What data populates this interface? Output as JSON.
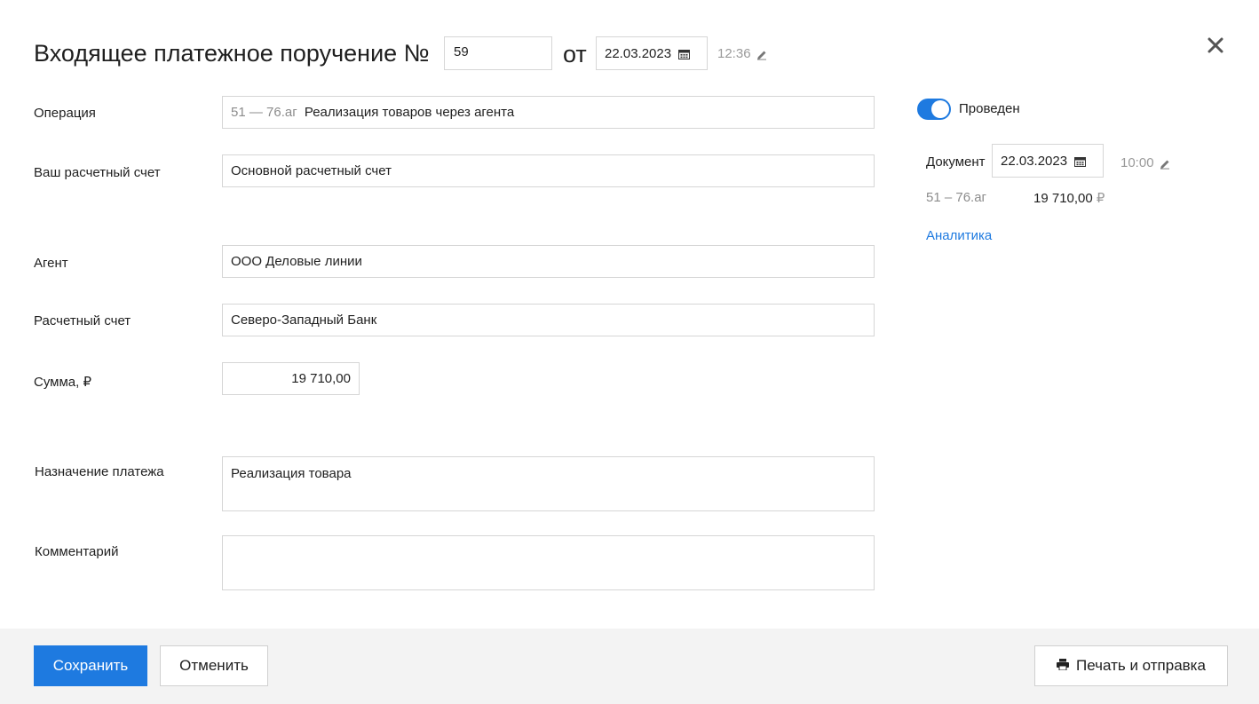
{
  "header": {
    "title": "Входящее платежное поручение №",
    "number": "59",
    "from_label": "от",
    "date": "22.03.2023",
    "time": "12:36"
  },
  "form": {
    "operation": {
      "label": "Операция",
      "code": "51 — 76.аг",
      "value": "Реализация товаров через агента"
    },
    "own_account": {
      "label": "Ваш расчетный счет",
      "value": "Основной расчетный счет"
    },
    "agent": {
      "label": "Агент",
      "value": "ООО Деловые линии"
    },
    "account": {
      "label": "Расчетный счет",
      "value": "Северо-Западный Банк"
    },
    "sum": {
      "label": "Сумма, ₽",
      "value": "19 710,00"
    },
    "purpose": {
      "label": "Назначение платежа",
      "value": "Реализация товара"
    },
    "comment": {
      "label": "Комментарий",
      "value": ""
    }
  },
  "side": {
    "posted_label": "Проведен",
    "posted": true,
    "document_label": "Документ",
    "document_date": "22.03.2023",
    "document_time": "10:00",
    "entry_code": "51 – 76.аг",
    "entry_sum": "19 710,00",
    "currency": "₽",
    "analytics_link": "Аналитика"
  },
  "footer": {
    "save_label": "Сохранить",
    "cancel_label": "Отменить",
    "print_label": "Печать и отправка"
  },
  "colors": {
    "accent": "#1e7ae0",
    "footer_bg": "#f3f3f3",
    "border": "#d6d6d6"
  },
  "icons": [
    "close-icon",
    "calendar-icon",
    "pencil-icon",
    "printer-icon"
  ]
}
